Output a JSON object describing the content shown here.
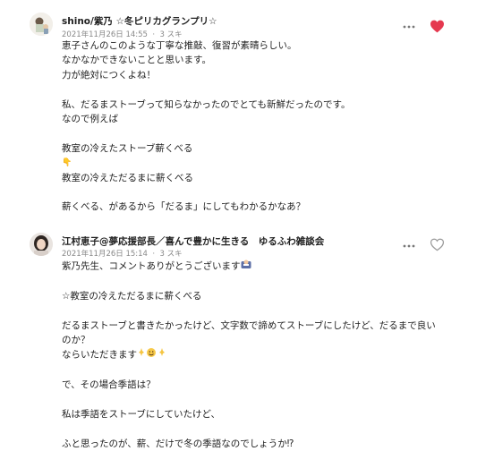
{
  "comments": [
    {
      "author": "shino/紫乃 ☆冬ピリカグランプリ☆",
      "date": "2021年11月26日 14:55",
      "likes": "3 スキ",
      "liked": true,
      "lines": [
        "恵子さんのこのような丁寧な推敲、復習が素晴らしい。",
        "なかなかできないことと思います。",
        "力が絶対につくよね！",
        "",
        "私、だるまストーブって知らなかったのでとても新鮮だったのです。",
        "なので例えば",
        "",
        "教室の冷えたストーブ薪くべる",
        "👇",
        "教室の冷えただるまに薪くべる",
        "",
        "薪くべる、があるから「だるま」にしてもわかるかなあ？"
      ]
    },
    {
      "author": "江村恵子@夢応援部長／喜んで豊かに生きる　ゆるふわ雑談会",
      "date": "2021年11月26日 15:14",
      "likes": "3 スキ",
      "liked": false,
      "lines": [
        "紫乃先生、コメントありがとうございます",
        "",
        "☆教室の冷えただるまに薪くべる",
        "",
        "だるまストーブと書きたかったけど、文字数で諦めてストーブにしたけど、だるまで良い",
        "のか？",
        "ならいただきます",
        "",
        "で、その場合季語は？",
        "",
        "私は季語をストーブにしていたけど、",
        "",
        "ふと思ったのが、薪、だけで冬の季語なのでしょうか⁉"
      ]
    }
  ],
  "icons": {
    "more": "more-dots-icon",
    "heart": "heart-icon",
    "accent_red": "#e5384f",
    "outline_gray": "#9a9a9a"
  }
}
